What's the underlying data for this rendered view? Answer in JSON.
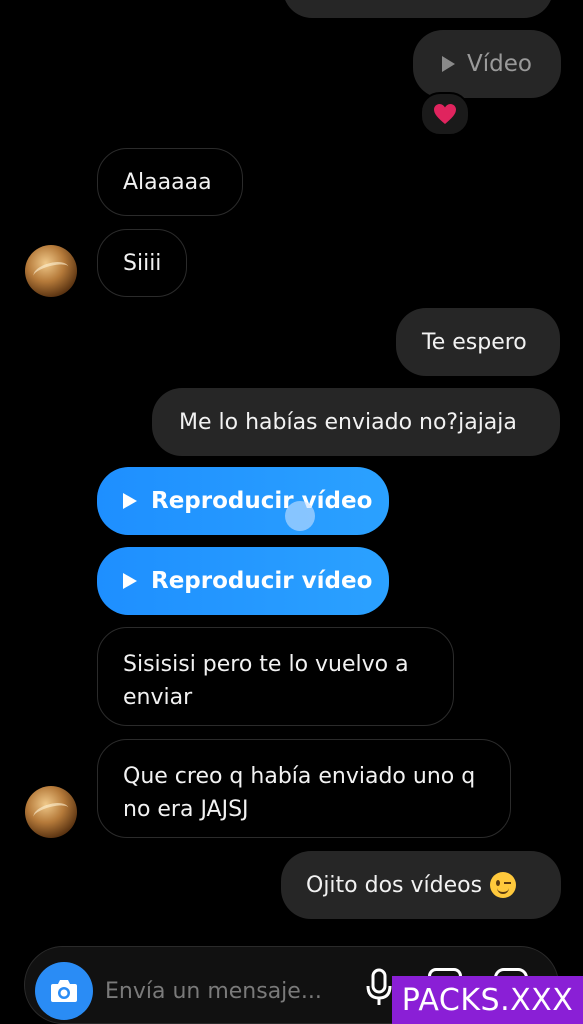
{
  "messages": {
    "video_label": "Vídeo",
    "reaction": "❤️",
    "alaaaaa": "Alaaaaa",
    "siiii": "Siiii",
    "te_espero": "Te espero",
    "me_lo": "Me lo habías enviado no?jajaja",
    "reproducir_1": "Reproducir vídeo",
    "reproducir_2": "Reproducir vídeo",
    "sisisisi": "Sisisisi pero te lo vuelvo a enviar",
    "que_creo": "Que creo q había enviado uno q no era JAJSJ",
    "ojito": "Ojito dos vídeos",
    "ojito_emoji": "😉"
  },
  "composer": {
    "placeholder": "Envía un mensaje..."
  },
  "watermark": "PACKS.XXX",
  "colors": {
    "blue_bubble": "#1e8fff",
    "outgoing_bubble": "#262626",
    "heart": "#e0245e",
    "watermark_bg": "#8a1fd6"
  }
}
